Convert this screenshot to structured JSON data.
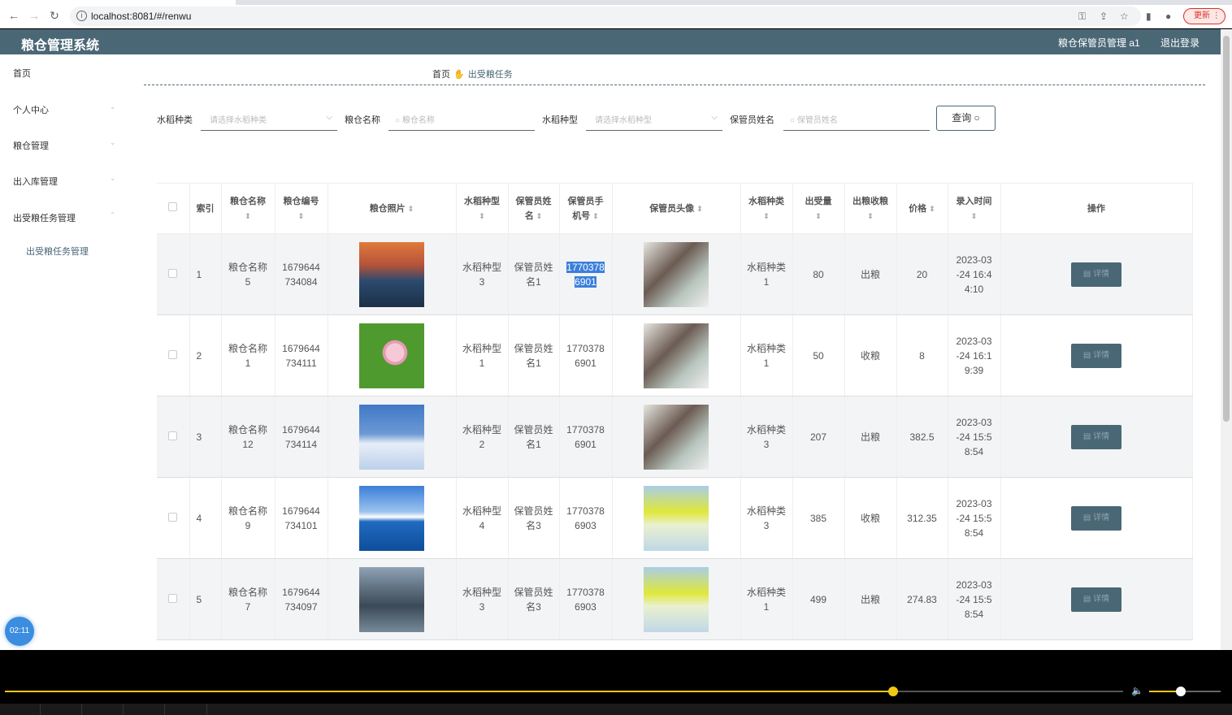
{
  "browser": {
    "url": "localhost:8081/#/renwu",
    "update_label": "更新"
  },
  "header": {
    "title": "粮仓管理系统",
    "user": "粮仓保管员管理 a1",
    "logout": "退出登录"
  },
  "sidebar": {
    "items": [
      {
        "label": "首页"
      },
      {
        "label": "个人中心"
      },
      {
        "label": "粮仓管理"
      },
      {
        "label": "出入库管理"
      },
      {
        "label": "出受粮任务管理"
      }
    ],
    "sub_items": [
      {
        "label": "出受粮任务管理"
      }
    ]
  },
  "breadcrumb": {
    "home": "首页",
    "current": "出受粮任务"
  },
  "filters": {
    "rice_kind_label": "水稻种类",
    "rice_kind_placeholder": "请选择水稻种类",
    "granary_name_label": "粮仓名称",
    "granary_name_placeholder": "粮仓名称",
    "rice_type_label": "水稻种型",
    "rice_type_placeholder": "请选择水稻种型",
    "keeper_name_label": "保管员姓名",
    "keeper_name_placeholder": "保管员姓名",
    "query_label": "查询"
  },
  "table": {
    "columns": [
      {
        "l1": "索引",
        "l2": ""
      },
      {
        "l1": "粮仓名称",
        "l2": ""
      },
      {
        "l1": "粮仓编号",
        "l2": ""
      },
      {
        "l1": "粮仓照片",
        "l2": ""
      },
      {
        "l1": "水稻种型",
        "l2": ""
      },
      {
        "l1": "保管员姓",
        "l2": "名"
      },
      {
        "l1": "保管员手",
        "l2": "机号"
      },
      {
        "l1": "保管员头像",
        "l2": ""
      },
      {
        "l1": "水稻种类",
        "l2": ""
      },
      {
        "l1": "出受量",
        "l2": ""
      },
      {
        "l1": "出粮收粮",
        "l2": ""
      },
      {
        "l1": "价格",
        "l2": ""
      },
      {
        "l1": "录入时间",
        "l2": ""
      },
      {
        "l1": "操作",
        "l2": ""
      }
    ],
    "rows": [
      {
        "index": "1",
        "name_a": "粮仓名称",
        "name_b": "5",
        "code_a": "1679644",
        "code_b": "734084",
        "type_a": "水稻种型",
        "type_b": "3",
        "keeper_a": "保管员姓",
        "keeper_b": "名1",
        "phone_a": "1770378",
        "phone_b": "6901",
        "kind_a": "水稻种类",
        "kind_b": "1",
        "qty": "80",
        "io": "出粮",
        "price": "20",
        "time_a": "2023-03",
        "time_b": "-24 16:4",
        "time_c": "4:10",
        "detail": "详情"
      },
      {
        "index": "2",
        "name_a": "粮仓名称",
        "name_b": "1",
        "code_a": "1679644",
        "code_b": "734111",
        "type_a": "水稻种型",
        "type_b": "1",
        "keeper_a": "保管员姓",
        "keeper_b": "名1",
        "phone_a": "1770378",
        "phone_b": "6901",
        "kind_a": "水稻种类",
        "kind_b": "1",
        "qty": "50",
        "io": "收粮",
        "price": "8",
        "time_a": "2023-03",
        "time_b": "-24 16:1",
        "time_c": "9:39",
        "detail": "详情"
      },
      {
        "index": "3",
        "name_a": "粮仓名称",
        "name_b": "12",
        "code_a": "1679644",
        "code_b": "734114",
        "type_a": "水稻种型",
        "type_b": "2",
        "keeper_a": "保管员姓",
        "keeper_b": "名1",
        "phone_a": "1770378",
        "phone_b": "6901",
        "kind_a": "水稻种类",
        "kind_b": "3",
        "qty": "207",
        "io": "出粮",
        "price": "382.5",
        "time_a": "2023-03",
        "time_b": "-24 15:5",
        "time_c": "8:54",
        "detail": "详情"
      },
      {
        "index": "4",
        "name_a": "粮仓名称",
        "name_b": "9",
        "code_a": "1679644",
        "code_b": "734101",
        "type_a": "水稻种型",
        "type_b": "4",
        "keeper_a": "保管员姓",
        "keeper_b": "名3",
        "phone_a": "1770378",
        "phone_b": "6903",
        "kind_a": "水稻种类",
        "kind_b": "3",
        "qty": "385",
        "io": "收粮",
        "price": "312.35",
        "time_a": "2023-03",
        "time_b": "-24 15:5",
        "time_c": "8:54",
        "detail": "详情"
      },
      {
        "index": "5",
        "name_a": "粮仓名称",
        "name_b": "7",
        "code_a": "1679644",
        "code_b": "734097",
        "type_a": "水稻种型",
        "type_b": "3",
        "keeper_a": "保管员姓",
        "keeper_b": "名3",
        "phone_a": "1770378",
        "phone_b": "6903",
        "kind_a": "水稻种类",
        "kind_b": "1",
        "qty": "499",
        "io": "出粮",
        "price": "274.83",
        "time_a": "2023-03",
        "time_b": "-24 15:5",
        "time_c": "8:54",
        "detail": "详情"
      }
    ]
  },
  "timer": "02:11",
  "player": {
    "progress_fraction": 0.794,
    "volume_fraction": 0.44
  },
  "colors": {
    "primary": "#4a6776",
    "accent": "#f2c811"
  }
}
